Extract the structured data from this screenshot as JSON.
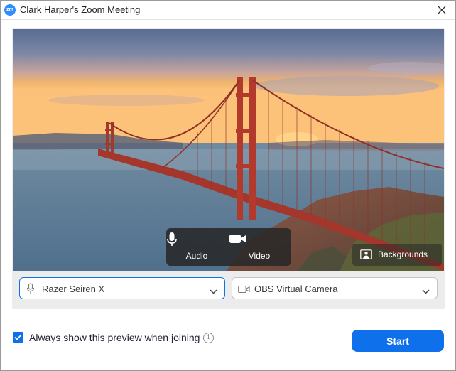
{
  "window": {
    "title": "Clark Harper's Zoom Meeting",
    "logo_text": "zm",
    "logo_icon": "zoom-logo-icon",
    "close_icon": "close-icon"
  },
  "preview": {
    "audio_label": "Audio",
    "audio_icon": "microphone-icon",
    "video_label": "Video",
    "video_icon": "video-camera-icon",
    "backgrounds_label": "Backgrounds",
    "backgrounds_icon": "virtual-background-icon"
  },
  "devices": {
    "microphone": {
      "selected": "Razer Seiren X",
      "icon": "microphone-icon"
    },
    "camera": {
      "selected": "OBS Virtual Camera",
      "icon": "video-camera-icon"
    }
  },
  "footer": {
    "always_show_label": "Always show this preview when joining",
    "always_show_checked": true,
    "start_label": "Start"
  },
  "colors": {
    "accent": "#0e71eb",
    "logo": "#2d8cff"
  }
}
